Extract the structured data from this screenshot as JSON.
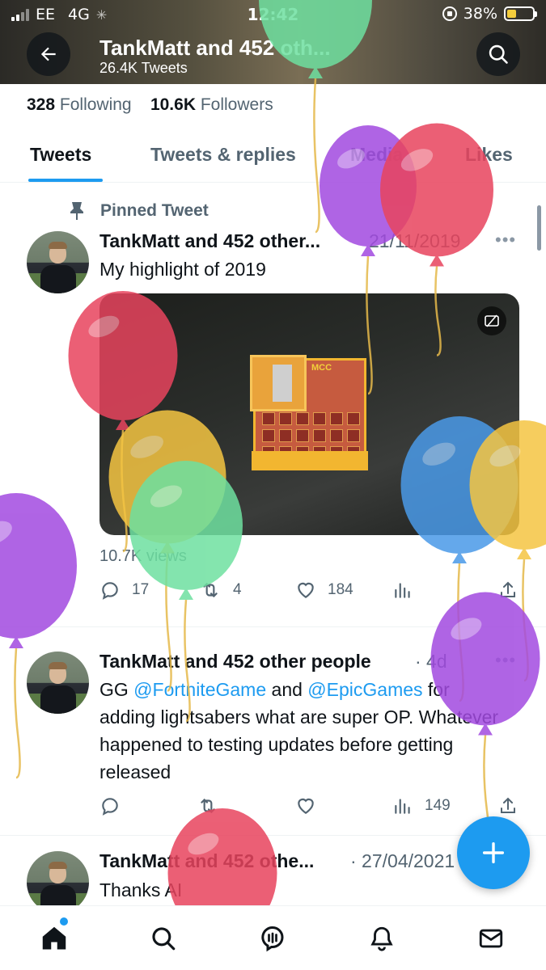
{
  "status_bar": {
    "carrier": "EE",
    "network": "4G",
    "time": "12:42",
    "battery_percent": "38%",
    "battery_level": 0.38
  },
  "header": {
    "title": "TankMatt and 452 oth...",
    "subtitle": "26.4K Tweets",
    "back_icon": "arrow-left-icon",
    "search_icon": "search-icon"
  },
  "profile": {
    "following_count": "328",
    "following_label": "Following",
    "followers_count": "10.6K",
    "followers_label": "Followers"
  },
  "tabs": [
    {
      "label": "Tweets",
      "active": true
    },
    {
      "label": "Tweets & replies",
      "active": false
    },
    {
      "label": "Media",
      "active": false
    },
    {
      "label": "Likes",
      "active": false
    }
  ],
  "tweets": [
    {
      "pinned_label": "Pinned Tweet",
      "author": "TankMatt and 452 other...",
      "date": "21/11/2019",
      "text": "My highlight of 2019",
      "views": "10.7K views",
      "replies": "17",
      "retweets": "4",
      "likes": "184"
    },
    {
      "author": "TankMatt and 452 other people",
      "date": "· 4d",
      "text_parts": [
        "GG ",
        "@FortniteGame",
        " and ",
        "@EpicGames",
        " for adding lightsabers what are super OP. Whatever happened to testing updates before getting released"
      ],
      "analytics": "149"
    },
    {
      "author": "TankMatt and 452 othe...",
      "date": "· 27/04/2021",
      "text": "Thanks AI"
    }
  ],
  "bottom_nav": [
    {
      "name": "home-icon",
      "active": true
    },
    {
      "name": "search-icon",
      "active": false
    },
    {
      "name": "spaces-icon",
      "active": false
    },
    {
      "name": "notifications-icon",
      "active": false
    },
    {
      "name": "messages-icon",
      "active": false
    }
  ],
  "fab_icon": "plus-icon",
  "colors": {
    "accent": "#1d9bf0",
    "text_primary": "#0f1419",
    "text_secondary": "#536471",
    "balloon_green": "#6ee0a0",
    "balloon_purple": "#a24ae0",
    "balloon_red": "#e8445e",
    "balloon_yellow": "#f5c542",
    "balloon_blue": "#4a9ae8"
  }
}
